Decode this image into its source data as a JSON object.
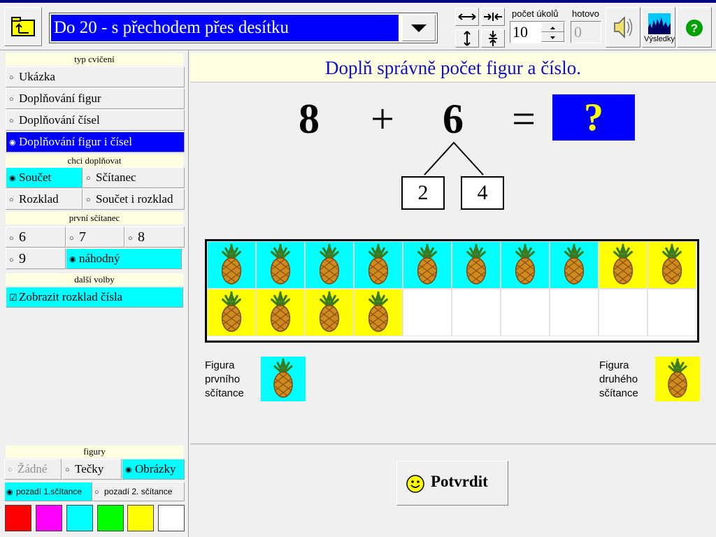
{
  "title": "Do 20 - s přechodem přes desítku",
  "counters": {
    "task_count_label": "počet úkolů",
    "task_count_value": "10",
    "done_label": "hotovo",
    "done_value": "0"
  },
  "toolbar": {
    "results_label": "Výsledky",
    "help_glyph": "?"
  },
  "exercise_type": {
    "header": "typ cvičení",
    "options": [
      "Ukázka",
      "Doplňování figur",
      "Doplňování čísel",
      "Doplňování figur i čísel"
    ],
    "selected": "Doplňování figur i čísel"
  },
  "fill_mode": {
    "header": "chci doplňovat",
    "options": [
      "Součet",
      "Sčítanec",
      "Rozklad",
      "Součet i rozklad"
    ],
    "selected": "Součet"
  },
  "first_addend": {
    "header": "první sčítanec",
    "options": [
      "6",
      "7",
      "8",
      "9",
      "náhodný"
    ],
    "selected": "náhodný"
  },
  "more_options": {
    "header": "další volby",
    "show_decomposition_label": "Zobrazit rozklad čísla",
    "show_decomposition_checked": true
  },
  "figures": {
    "header": "figury",
    "options": [
      "Žádné",
      "Tečky",
      "Obrázky"
    ],
    "selected": "Obrázky",
    "background_options": [
      "pozadí 1.sčítance",
      "pozadí 2. sčítance"
    ],
    "background_selected": "pozadí 1.sčítance",
    "palette": [
      "#ff0000",
      "#ff00ff",
      "#00ffff",
      "#00ff00",
      "#ffff00",
      "#ffffff"
    ]
  },
  "instruction": "Doplň správně počet figur a číslo.",
  "equation": {
    "a": "8",
    "op": "+",
    "b": "6",
    "eq": "=",
    "answer": "?",
    "decomposition": [
      "2",
      "4"
    ]
  },
  "grid": {
    "rows": 2,
    "cols": 10,
    "first_addend_count": 8,
    "second_addend_count": 6,
    "first_color": "#00ffff",
    "second_color": "#ffff00"
  },
  "legend": {
    "first": "Figura prvního sčítance",
    "first_lines": [
      "Figura",
      "prvního",
      "sčítance"
    ],
    "second": "Figura druhého sčítance",
    "second_lines": [
      "Figura",
      "druhého",
      "sčítance"
    ]
  },
  "confirm_label": "Potvrdit"
}
